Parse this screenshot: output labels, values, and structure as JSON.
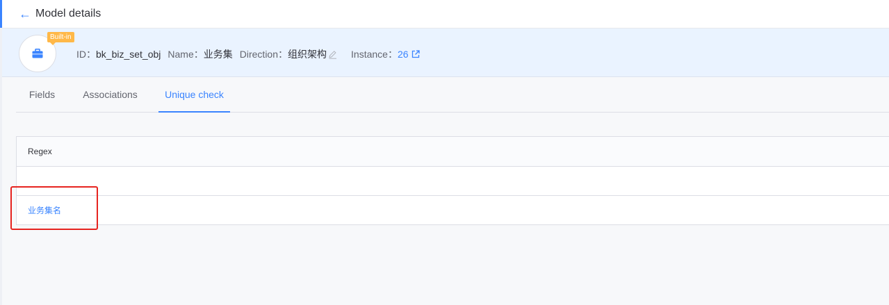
{
  "header": {
    "back_icon": "arrow-left-icon",
    "title": "Model details"
  },
  "model": {
    "icon": "briefcase-icon",
    "badge": "Built-in",
    "id_label": "ID：",
    "id_value": "bk_biz_set_obj",
    "name_label": "Name：",
    "name_value": "业务集",
    "direction_label": "Direction：",
    "direction_value": "组织架构",
    "instance_label": "Instance：",
    "instance_value": "26"
  },
  "tabs": [
    {
      "label": "Fields"
    },
    {
      "label": "Associations"
    },
    {
      "label": "Unique check",
      "active": true
    }
  ],
  "table": {
    "column_header": "Regex",
    "rows": [
      {
        "value": ""
      },
      {
        "value": "业务集名"
      }
    ]
  },
  "colors": {
    "accent": "#3a84ff",
    "badge": "#ffb848",
    "highlight": "#e6231f",
    "info_bg": "#eaf3ff"
  }
}
